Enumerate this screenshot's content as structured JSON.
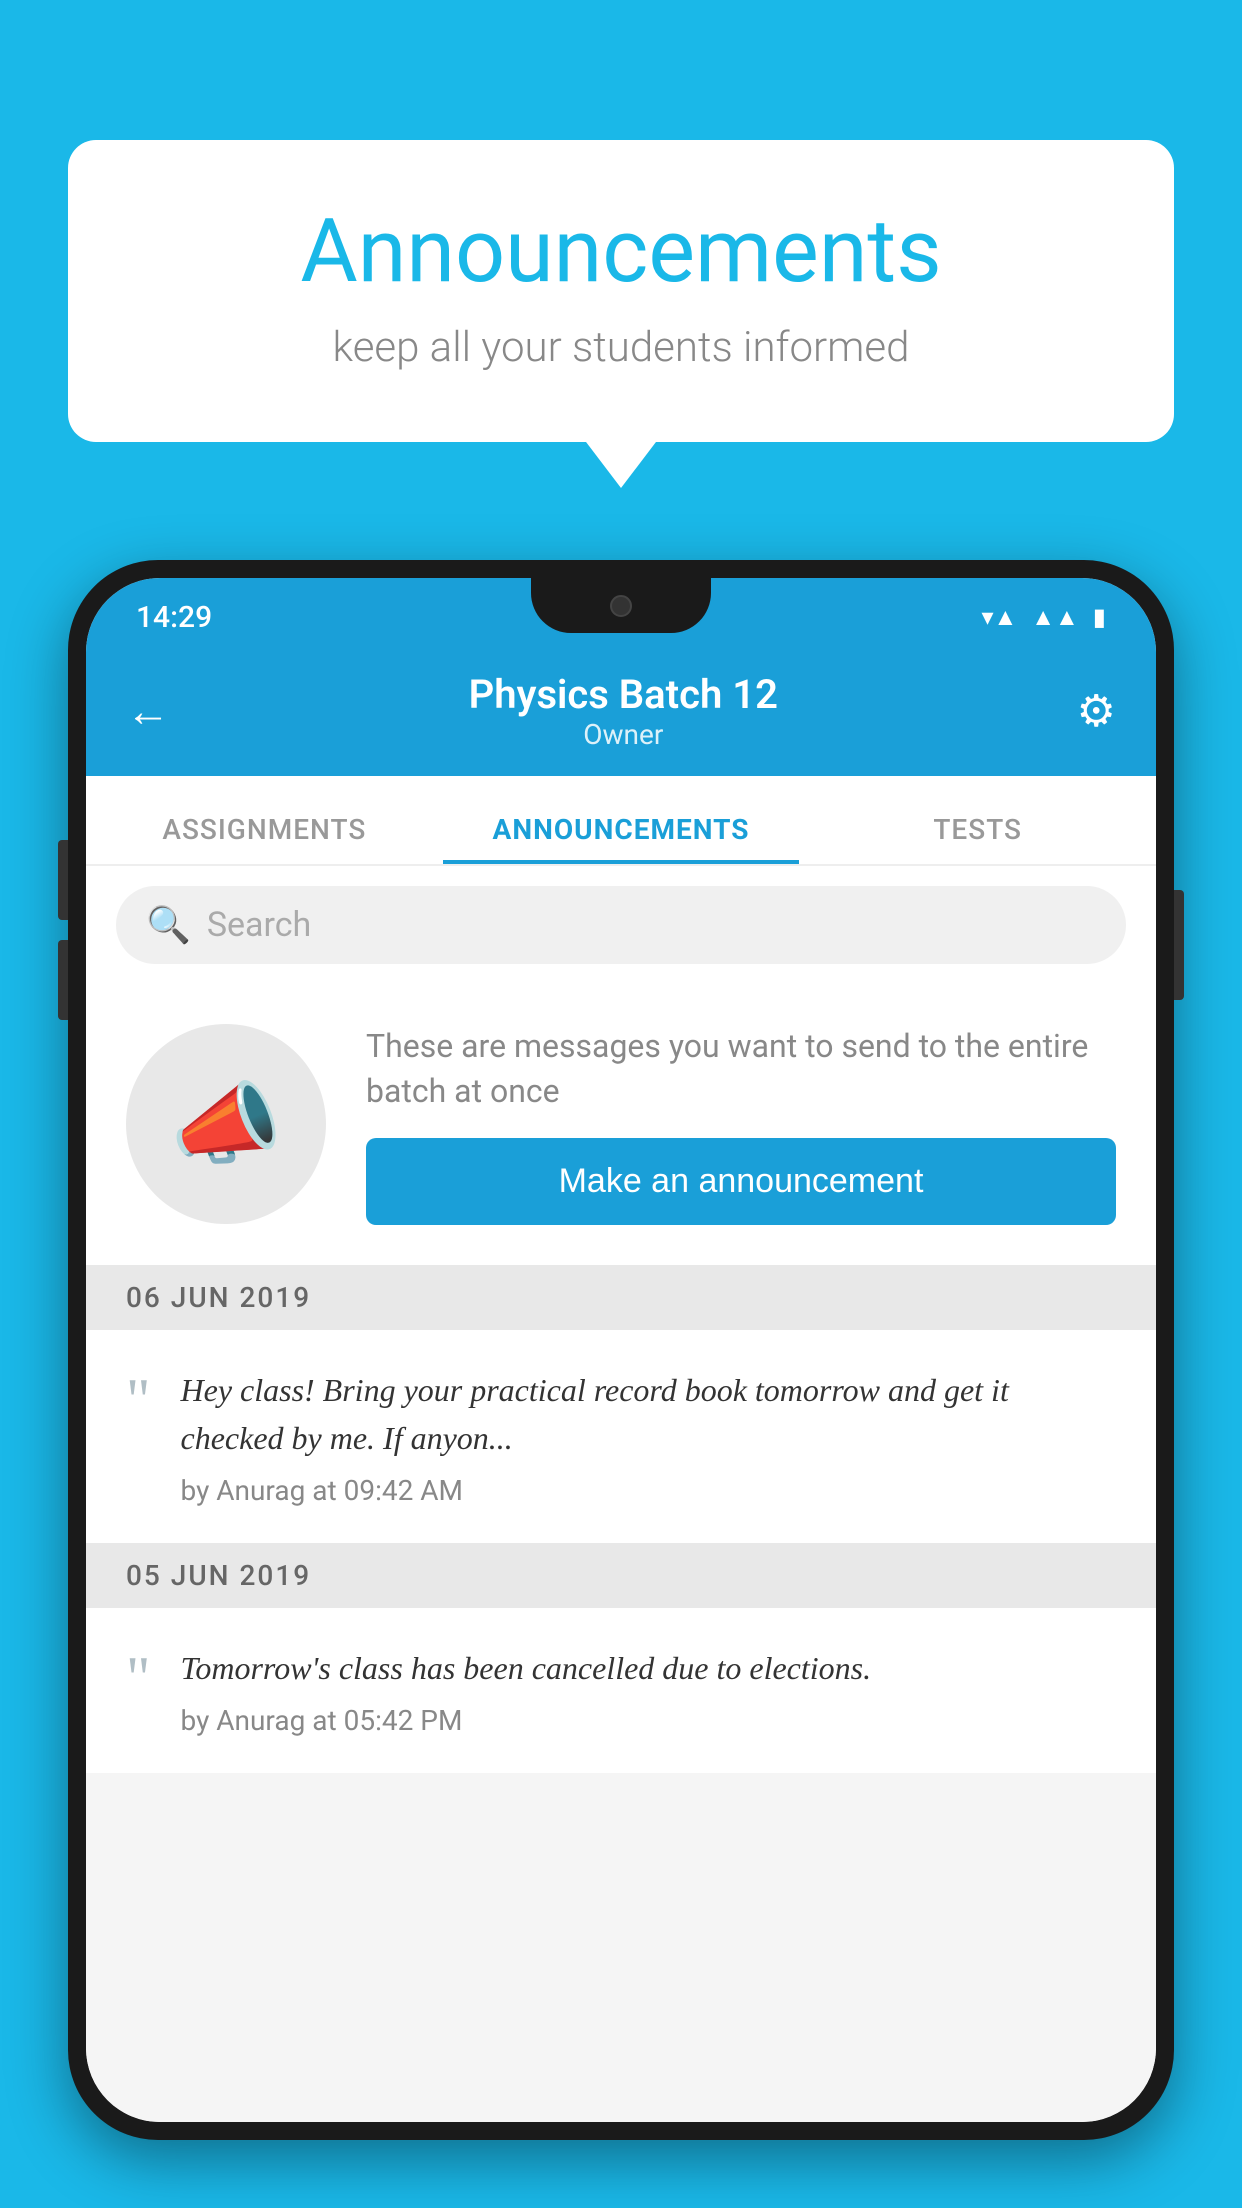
{
  "bubble": {
    "title": "Announcements",
    "subtitle": "keep all your students informed"
  },
  "phone": {
    "statusBar": {
      "time": "14:29"
    },
    "appBar": {
      "title": "Physics Batch 12",
      "subtitle": "Owner",
      "backLabel": "←",
      "settingsLabel": "⚙"
    },
    "tabs": [
      {
        "label": "ASSIGNMENTS",
        "active": false
      },
      {
        "label": "ANNOUNCEMENTS",
        "active": true
      },
      {
        "label": "TESTS",
        "active": false
      }
    ],
    "search": {
      "placeholder": "Search"
    },
    "announcementCard": {
      "description": "These are messages you want to\nsend to the entire batch at once",
      "buttonLabel": "Make an announcement"
    },
    "dateSections": [
      {
        "date": "06  JUN  2019",
        "messages": [
          {
            "text": "Hey class! Bring your practical record book tomorrow and get it checked by me. If anyon...",
            "meta": "by Anurag at 09:42 AM"
          }
        ]
      },
      {
        "date": "05  JUN  2019",
        "messages": [
          {
            "text": "Tomorrow's class has been cancelled due to elections.",
            "meta": "by Anurag at 05:42 PM"
          }
        ]
      }
    ]
  }
}
